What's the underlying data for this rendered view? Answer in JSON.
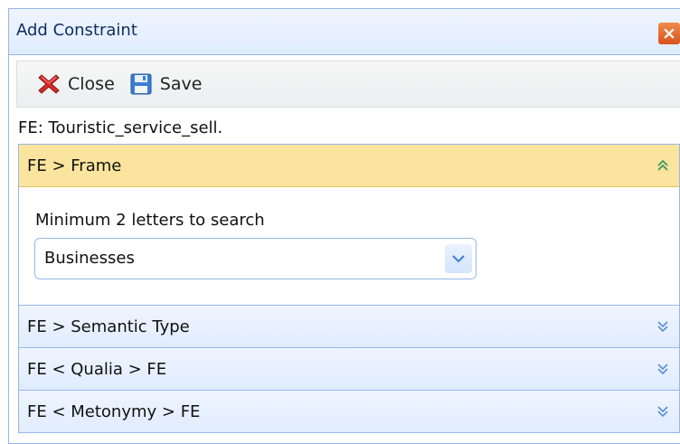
{
  "dialog": {
    "title": "Add Constraint",
    "close_glyph": "×"
  },
  "toolbar": {
    "close_label": "Close",
    "save_label": "Save"
  },
  "fe_label": "FE: Touristic_service_sell.",
  "accordion": {
    "panels": [
      {
        "title": "FE > Frame",
        "expanded": true,
        "hint": "Minimum 2 letters to search",
        "combo_value": "Businesses"
      },
      {
        "title": "FE > Semantic Type",
        "expanded": false
      },
      {
        "title": "FE < Qualia > FE",
        "expanded": false
      },
      {
        "title": "FE < Metonymy > FE",
        "expanded": false
      }
    ]
  },
  "colors": {
    "panel_border": "#95b8e7",
    "active_header": "#fbe49d",
    "header_gradient": "#e0ecff",
    "title_close_button": "#d9531e"
  },
  "icons": {
    "close": "red-x-icon",
    "save": "floppy-disk-icon",
    "expanded": "double-chevron-up-icon",
    "collapsed": "double-chevron-down-icon",
    "combo": "chevron-down-icon"
  }
}
